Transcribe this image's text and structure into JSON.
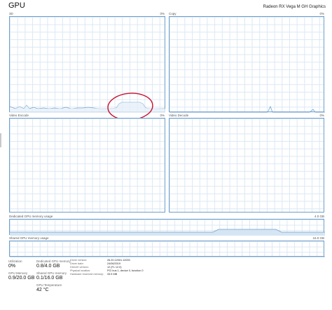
{
  "header": {
    "title": "GPU",
    "adapter": "Radeon RX Vega M GH Graphics"
  },
  "graphs": {
    "g3d": {
      "label": "3D",
      "pct": "0%"
    },
    "copy": {
      "label": "Copy",
      "pct": "0%"
    },
    "encode": {
      "label": "Video Encode",
      "pct": "0%"
    },
    "decode": {
      "label": "Video Decode",
      "pct": "0%"
    },
    "pct_right_3d": "0%",
    "pct_right_encode": "0%"
  },
  "memory_graphs": {
    "dedicated": {
      "label": "Dedicated GPU memory usage",
      "max": "4.0 GB"
    },
    "shared": {
      "label": "Shared GPU memory usage",
      "max": "16.0 GB"
    }
  },
  "stats": {
    "utilization_label": "Utilization",
    "utilization_value": "0%",
    "dedicated_label": "Dedicated GPU memory",
    "dedicated_value": "0.8/4.0 GB",
    "gpu_memory_label": "GPU Memory",
    "gpu_memory_value": "0.9/20.0 GB",
    "shared_label": "Shared GPU memory",
    "shared_value": "0.1/16.0 GB",
    "temp_label": "GPU Temperature",
    "temp_value": "42 °C"
  },
  "details": {
    "keys": [
      "Driver version:",
      "Driver date:",
      "DirectX version:",
      "Physical location:",
      "Hardware reserved memory:"
    ],
    "values": [
      "26.20.12001.12000",
      "24/06/2019",
      "12 (FL 12.0)",
      "PCI bus 1, device 0, function 0",
      "33.5 MB"
    ]
  },
  "annotation": {
    "color": "#c8102e"
  },
  "accent": "#6f9fce"
}
